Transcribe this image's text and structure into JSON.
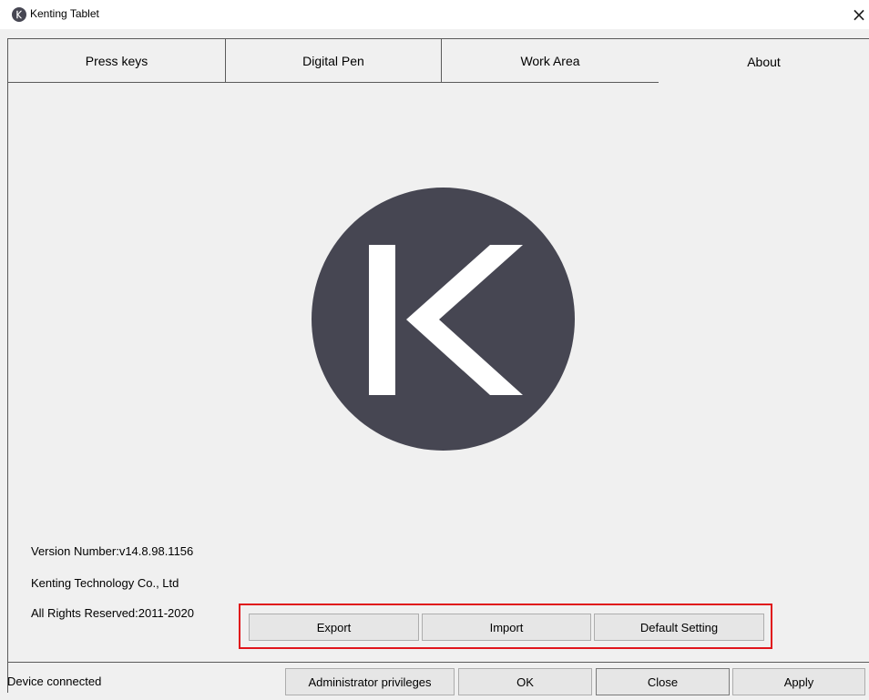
{
  "window": {
    "title": "Kenting Tablet",
    "close_glyph": "×",
    "icon": "kenting-logo-icon"
  },
  "tabs": [
    {
      "label": "Press keys",
      "active": false
    },
    {
      "label": "Digital Pen",
      "active": false
    },
    {
      "label": "Work Area",
      "active": false
    },
    {
      "label": "About",
      "active": true
    }
  ],
  "about": {
    "logo_letter": "K",
    "logo_color": "#464652",
    "version": "Version Number:v14.8.98.1156",
    "company": "Kenting Technology Co., Ltd",
    "rights": "All Rights Reserved:2011-2020"
  },
  "actions": {
    "export_label": "Export",
    "import_label": "Import",
    "default_label": "Default Setting",
    "highlight_color": "#e0151b"
  },
  "footer": {
    "status": "Device connected",
    "admin_label": "Administrator privileges",
    "ok_label": "OK",
    "close_label": "Close",
    "apply_label": "Apply"
  }
}
